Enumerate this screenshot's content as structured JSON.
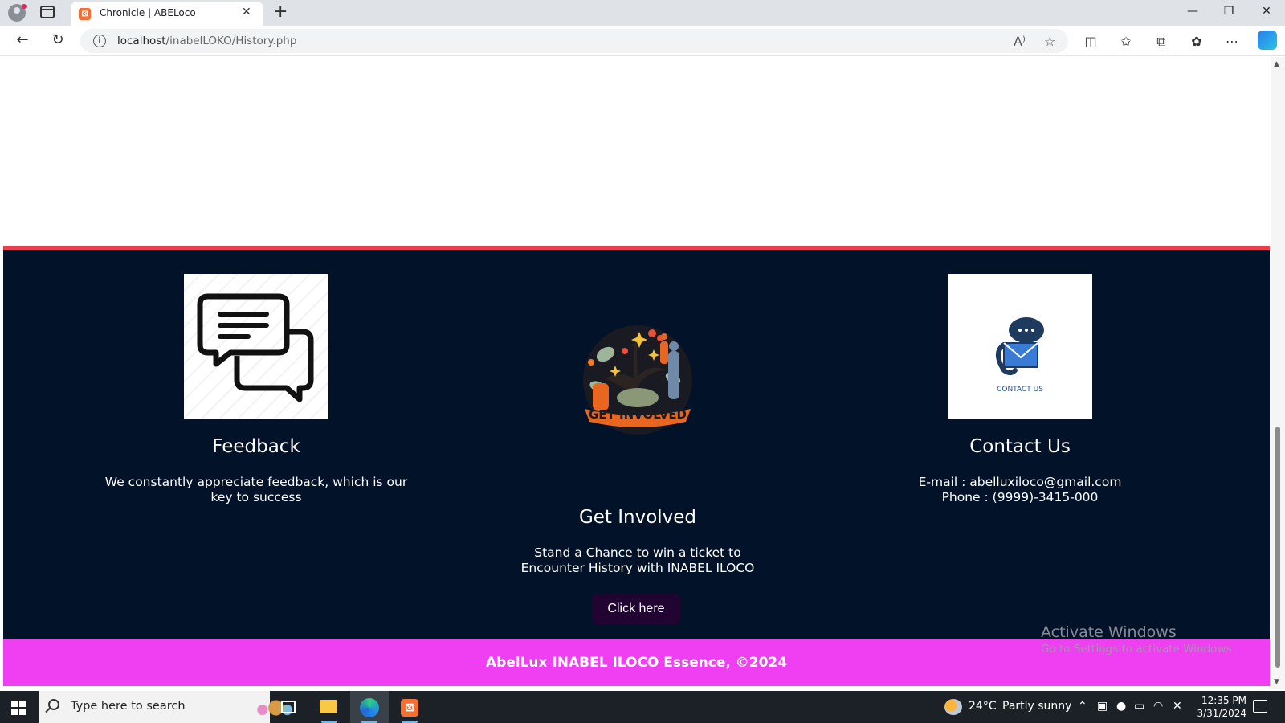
{
  "browser": {
    "tab_title": "Chronicle | ABELoco",
    "url_host": "localhost",
    "url_path": "/inabelLOKO/History.php"
  },
  "footer": {
    "feedback": {
      "title": "Feedback",
      "text_line1": "We constantly appreciate feedback, which is our",
      "text_line2": "key to success"
    },
    "get_involved": {
      "image_text": "GET INVOLVED",
      "title": "Get Involved",
      "text_line1": "Stand a Chance to win a ticket to",
      "text_line2": "Encounter History with INABEL ILOCO",
      "button_label": "Click here"
    },
    "contact": {
      "image_text": "CONTACT US",
      "title": "Contact Us",
      "email": "E-mail : abelluxiloco@gmail.com",
      "phone": "Phone : (9999)-3415-000"
    },
    "copyright": "AbelLux INABEL ILOCO Essence, ©2024",
    "colors": {
      "footer_bg": "#021229",
      "top_border": "#e6414f",
      "bottom_bar": "#f03ef2",
      "button_bg": "#210431"
    }
  },
  "watermark": {
    "title": "Activate Windows",
    "subtitle": "Go to Settings to activate Windows."
  },
  "taskbar": {
    "search_placeholder": "Type here to search",
    "weather_temp": "24°C",
    "weather_desc": "Partly sunny",
    "time": "12:35 PM",
    "date": "3/31/2024"
  }
}
